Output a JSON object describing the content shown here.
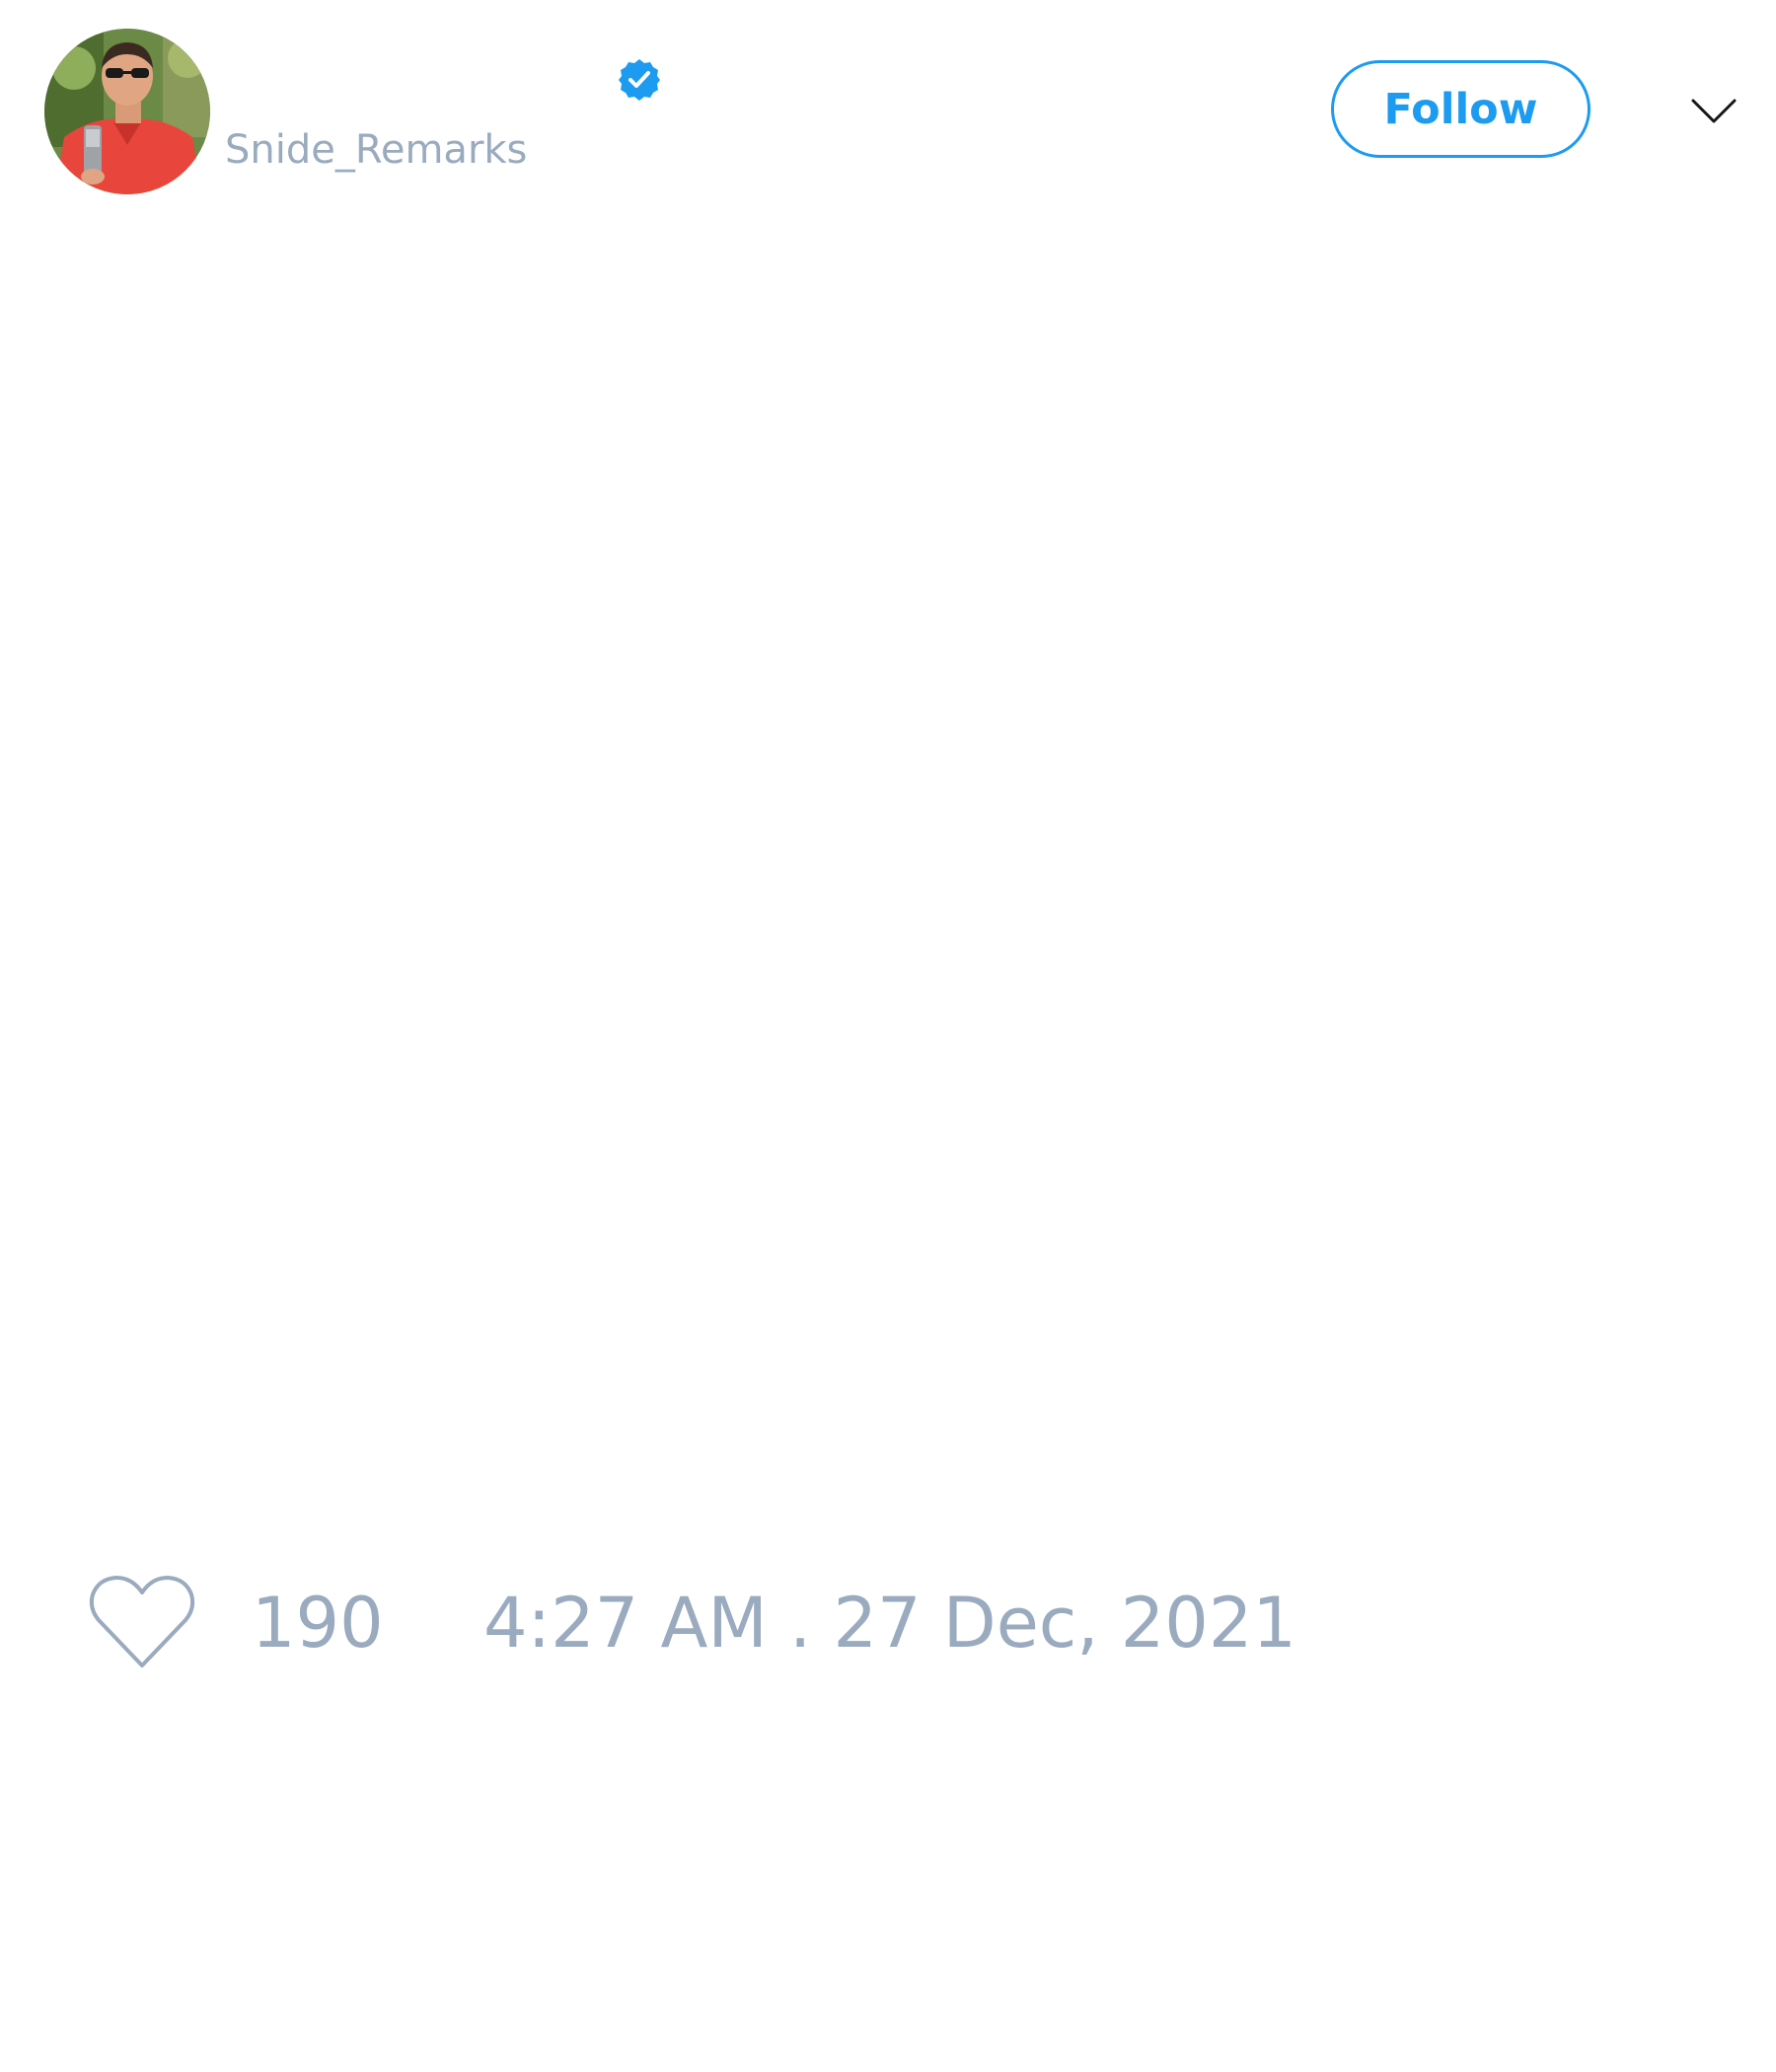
{
  "tweet": {
    "display_name": "",
    "handle": "Snide_Remarks",
    "verified": true,
    "avatar_alt": "profile photo",
    "follow_label": "Follow",
    "like_count": "190",
    "timestamp": "4:27 AM . 27 Dec, 2021"
  },
  "icons": {
    "verified": "verified-badge-icon",
    "more": "chevron-down-icon",
    "like": "heart-icon"
  },
  "colors": {
    "accent": "#1d9bf0",
    "muted_text": "#9aaabf",
    "background": "#ffffff"
  }
}
